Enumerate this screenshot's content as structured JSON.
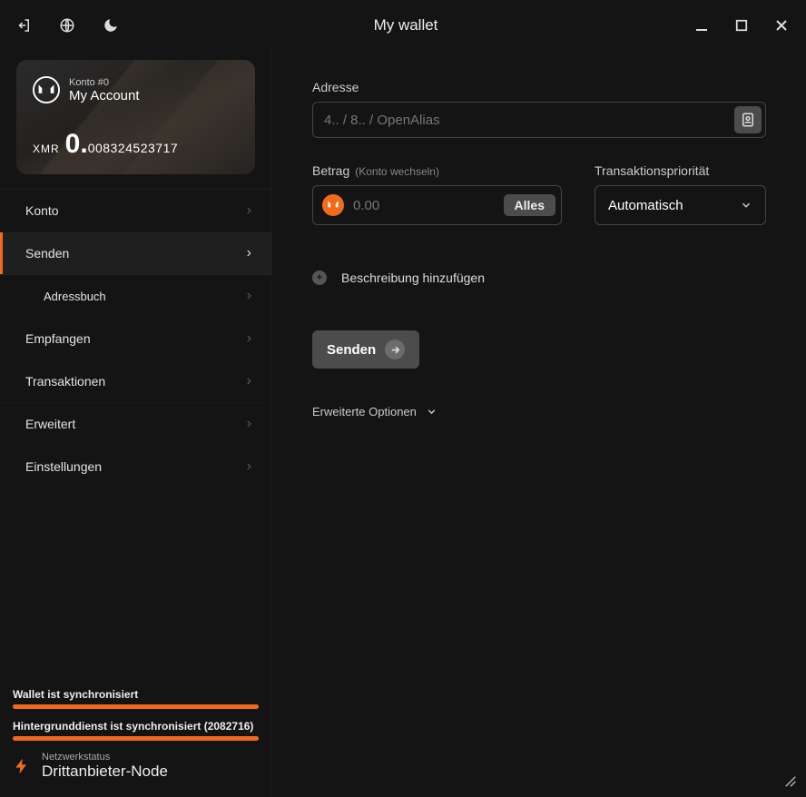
{
  "titlebar": {
    "title": "My wallet"
  },
  "account": {
    "sub": "Konto #0",
    "name": "My Account",
    "currency": "XMR",
    "balance_big": "0.",
    "balance_small": "008324523717"
  },
  "nav": {
    "konto": "Konto",
    "senden": "Senden",
    "adressbuch": "Adressbuch",
    "empfangen": "Empfangen",
    "transaktionen": "Transaktionen",
    "erweitert": "Erweitert",
    "einstellungen": "Einstellungen"
  },
  "sync": {
    "wallet_label": "Wallet ist synchronisiert",
    "daemon_label": "Hintergrunddienst ist synchronisiert (2082716)",
    "color": "#f26b1d"
  },
  "netstatus": {
    "sub": "Netzwerkstatus",
    "main": "Drittanbieter-Node"
  },
  "form": {
    "address_label": "Adresse",
    "address_placeholder": "4.. / 8.. / OpenAlias",
    "amount_label": "Betrag",
    "amount_hint": "(Konto wechseln)",
    "amount_placeholder": "0.00",
    "all_button": "Alles",
    "priority_label": "Transaktionspriorität",
    "priority_value": "Automatisch",
    "add_description": "Beschreibung hinzufügen",
    "send_button": "Senden",
    "advanced_options": "Erweiterte Optionen"
  }
}
